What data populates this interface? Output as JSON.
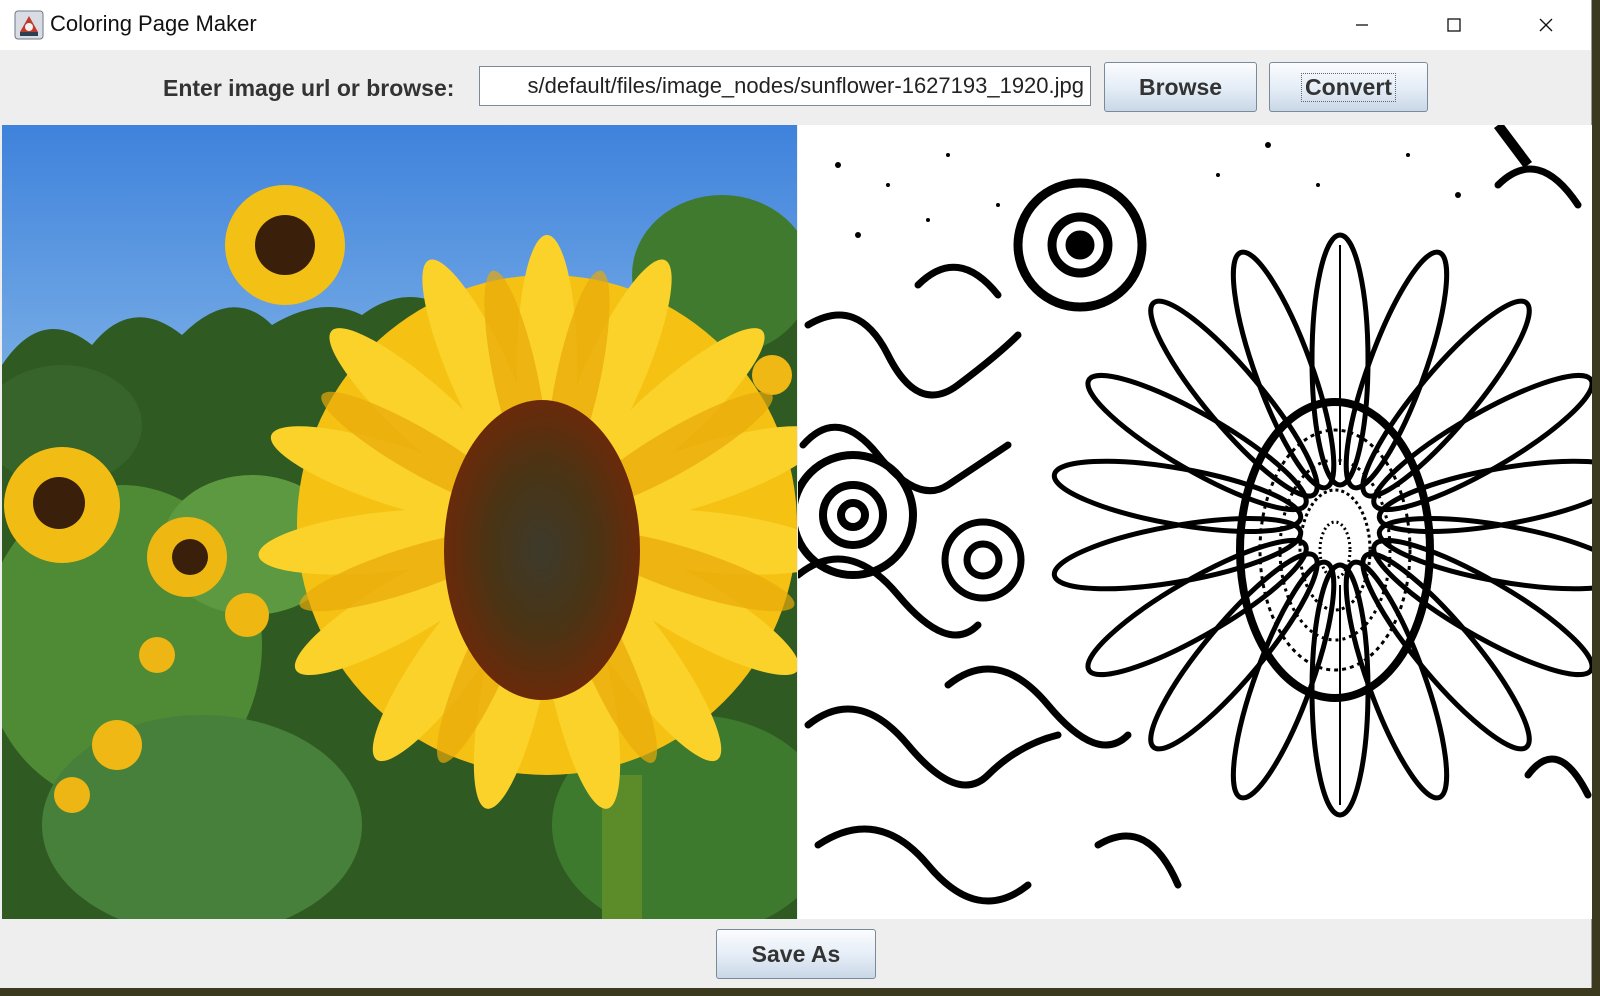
{
  "window": {
    "title": "Coloring Page Maker",
    "icons": {
      "app": "java-app-icon",
      "minimize": "minimize-icon",
      "maximize": "maximize-icon",
      "close": "close-icon"
    }
  },
  "toolbar": {
    "label": "Enter image url or browse:",
    "url_value": "s/default/files/image_nodes/sunflower-1627193_1920.jpg",
    "browse_label": "Browse",
    "convert_label": "Convert"
  },
  "footer": {
    "save_label": "Save As"
  },
  "colors": {
    "sky": "#4a8de0",
    "petal": "#f7c512",
    "leaf": "#4f8a35",
    "center": "#4a2c0c",
    "button_top": "#fbfcfe",
    "button_bottom": "#c9d7e6"
  }
}
